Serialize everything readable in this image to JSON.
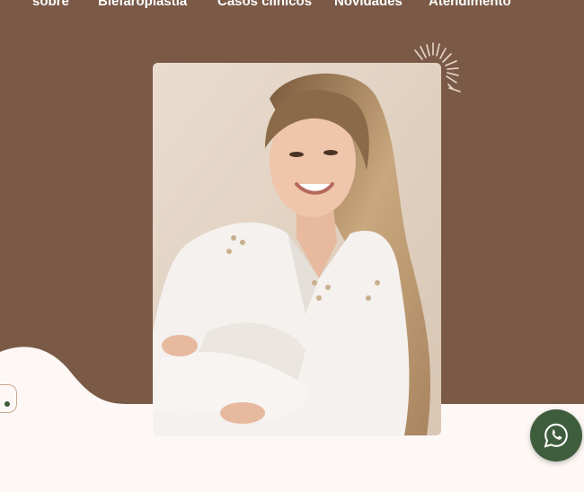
{
  "nav": {
    "items": [
      {
        "label": "sobre"
      },
      {
        "label": "Blefaroplastia"
      },
      {
        "label": "Casos clínicos"
      },
      {
        "label": "Novidades"
      },
      {
        "label": "Atendimento"
      }
    ]
  },
  "colors": {
    "hero_background": "#7a5947",
    "page_background": "#fdf8f5",
    "whatsapp_button": "#3e5d3d",
    "accent_dot": "#3e5a3a"
  },
  "icons": {
    "whatsapp": "whatsapp-icon",
    "burst": "sparkle-burst-icon"
  }
}
